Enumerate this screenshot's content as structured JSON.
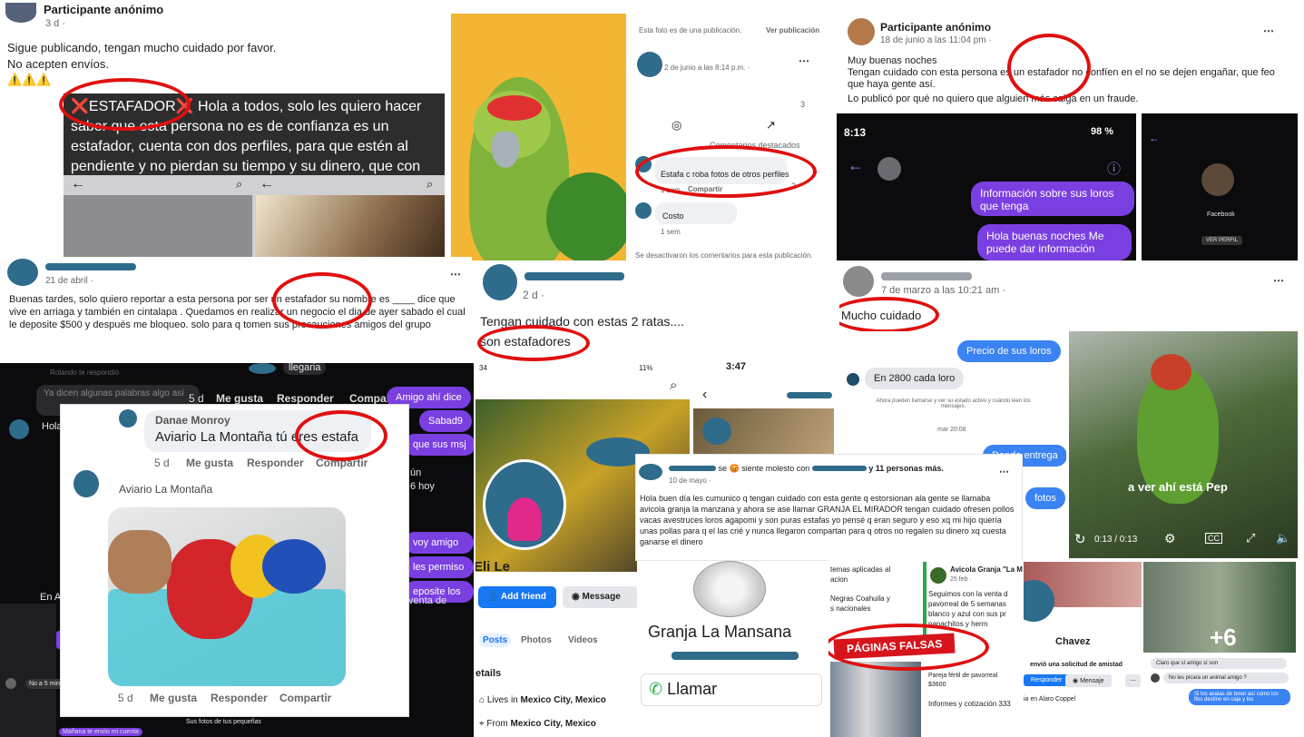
{
  "p1": {
    "name": "Participante anónimo",
    "time": "3 d ·",
    "line1": "Sigue publicando, tengan mucho cuidado por favor.",
    "line2": "No acepten envíos.",
    "emoji": "⚠️⚠️⚠️",
    "banner_tag": "❌ESTAFADOR❌",
    "banner_rest": " Hola a todos, solo les quiero hacer saber que esta persona no es de confianza es un estafador, cuenta con dos perfiles, para que estén al pendiente y no pierdan su tiempo y su dinero, que con mucho esfuerzo y trabajo ganan"
  },
  "p2": {
    "top": "Esta foto es de una publicación.",
    "top_link": "Ver publicación",
    "time": "2 de junio a las 8:14 p.m. ·",
    "count": "3",
    "sort": "Comentarios destacados",
    "c1": "Estafa c roba fotos de otros perfiles",
    "c1_meta": "1 sem",
    "reply": "Compartir",
    "c1_react": "2",
    "c2": "Costo",
    "c2_meta": "1 sem",
    "footer": "Se desactivaron los comentarios para esta publicación."
  },
  "p3": {
    "name": "Participante anónimo",
    "time": "18 de junio a las 11:04 pm ·",
    "l1": "Muy buenas noches",
    "l2": "Tengan cuidado con esta persona es un estafador  no confíen en el no se dejen engañar, que feo que haya gente así.",
    "l3": "Lo publicó por qué no quiero que alguien más caiga en un fraude.",
    "clock": "8:13",
    "battery": "98 %",
    "bub1": "Información sobre sus loros que tenga",
    "bub2": "Hola buenas noches Me puede dar información",
    "fb": "Facebook",
    "ver": "VER PERFIL"
  },
  "p4": {
    "time": "21 de abril ·",
    "text": "Buenas tardes, solo quiero reportar a esta persona por ser un estafador su nombre es ____ dice que vive en arriaga y también en cintalapa . Quedamos en realizar un negocio el dia de ayer sabado el cual le deposite $500 y después me bloqueo. solo para q tomen sus precauciones amigos del grupo"
  },
  "p5": {
    "time": "2 d ·",
    "l1": "Tengan cuidado con estas 2 ratas....",
    "l2": "son estafadores"
  },
  "p6": {
    "time": "7 de marzo a las 10:21 am ·",
    "text": "Mucho cuidado",
    "q": "Precio de sus loros",
    "a": "En 2800 cada loro",
    "sys": "Ahora pueden llamarse y ver su estado activo y cuándo leen los mensajes.",
    "date": "mar 20:08",
    "r1": "Donde entrega",
    "r2": "fotos",
    "cap": "a ver ahí está Pep",
    "vtime": "0:13 / 0:13"
  },
  "p7": {
    "replied": "Rolando te respondió",
    "faded": "Ya dicen algunas palabras algo así",
    "h": "Hola",
    "l1": "5 d",
    "l2": "Me gusta",
    "l3": "Responder",
    "l4": "Compartir",
    "llegaria": "llegaria",
    "b1": "Amigo ahí dice",
    "b2": "Sabad9",
    "b3": "que sus msj",
    "b4": "voy amigo",
    "b5": "les permiso",
    "b6": "eposite los",
    "b7": "venta de",
    "en": "En A",
    "hoy": "ún",
    "hoy2": "6 hoy",
    "min": "No a 5 min",
    "f1": "Sus fotos de tus pequeñas",
    "f2": "Mañana te envio mi cuenta"
  },
  "p8": {
    "author": "Danae Monroy",
    "comment": "Aviario La Montaña tú eres estafa",
    "time": "5 d",
    "like": "Me gusta",
    "reply": "Responder",
    "share": "Compartir",
    "poster": "Aviario La Montaña",
    "time2": "5 d"
  },
  "p9": {
    "status": "3:47",
    "left": "34",
    "battery": "11%",
    "name": "Eli Le",
    "add": "Add friend",
    "msg": "Message",
    "tab1": "Posts",
    "tab2": "Photos",
    "tab3": "Videos",
    "details": "etails",
    "lives_pre": "Lives in ",
    "lives": "Mexico City, Mexico",
    "from_pre": "From ",
    "from": "Mexico City, Mexico"
  },
  "p10": {
    "mid": " se 😡 siente molesto con ",
    "suffix": "y 11 personas más.",
    "time": "10 de mayo ·",
    "text": "Hola buen día les cumunico q tengan cuidado con esta gente q estorsionan ala gente se llamaba avicola granja la manzana y ahora se ase llamar GRANJA EL MIRADOR tengan cuidado ofresen pollos vacas avestruces loros agapomi y son puras estafas yo pensé q eran seguro y eso xq mi hijo quería unas pollas para q el las crié y nunca llegaron compartan para q otros no regalen su dinero xq cuesta ganarse el dinero"
  },
  "p11": {
    "name": "Granja La Mansana",
    "call": "Llamar"
  },
  "p12": {
    "t1": "temas aplicadas al",
    "t2": "acion",
    "t3": "Negras Coahuila y",
    "t4": "s nacionales",
    "page": "Avicola Granja \"La M",
    "date": "25 feb ·",
    "x1": "Seguimos con la venta d",
    "x2": "pavorreal  de 5 semanas",
    "x3": "blanco y azul  con sus pr",
    "x4": "panachitos y herm",
    "x5": "Pareja fértil de pavorreal",
    "x6": "$3600",
    "x7": "Informes y cotización  333",
    "banner": "PÁGINAS FALSAS"
  },
  "p13": {
    "name": "Chavez",
    "req": "envió una solicitud de amistad",
    "resp": "Responder",
    "msj": "Mensaje",
    "city": "ia en Alaro Coppel",
    "plus": "+6",
    "m1": "Claro que sí amigo sí son",
    "m2": "No les picara un animal amigo ?",
    "m3": "Si los avalas de tener así como los flos destino en caja y los"
  }
}
